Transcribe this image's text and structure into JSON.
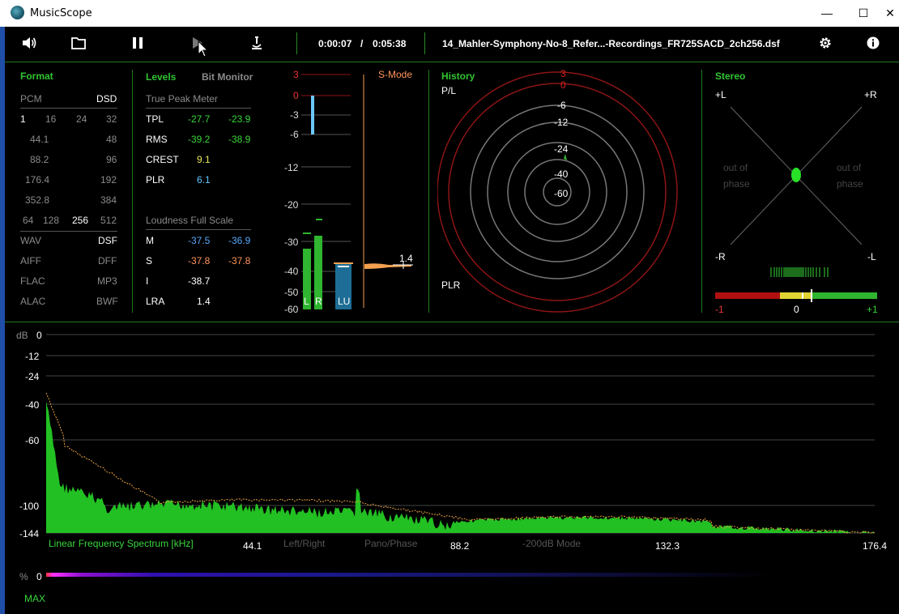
{
  "window": {
    "title": "MusicScope",
    "minimize": "—",
    "maximize": "☐",
    "close": "✕"
  },
  "toolbar": {
    "time_current": "0:00:07",
    "time_sep": "/",
    "time_total": "0:05:38",
    "filename": "14_Mahler-Symphony-No-8_Refer...-Recordings_FR725SACD_2ch256.dsf"
  },
  "format": {
    "title": "Format",
    "pcm": "PCM",
    "dsd": "DSD",
    "bits": [
      "1",
      "16",
      "24",
      "32"
    ],
    "rates_left": [
      "44.1",
      "88.2",
      "176.4",
      "352.8"
    ],
    "rates_right": [
      "48",
      "96",
      "192",
      "384"
    ],
    "dsd_rates": [
      "64",
      "128",
      "256",
      "512"
    ],
    "files_left": [
      "WAV",
      "AIFF",
      "FLAC",
      "ALAC"
    ],
    "files_right": [
      "DSF",
      "DFF",
      "MP3",
      "BWF"
    ]
  },
  "levels": {
    "title": "Levels",
    "bit_monitor": "Bit Monitor",
    "true_peak_title": "True Peak Meter",
    "tpl_label": "TPL",
    "tpl_l": "-27.7",
    "tpl_r": "-23.9",
    "rms_label": "RMS",
    "rms_l": "-39.2",
    "rms_r": "-38.9",
    "crest_label": "CREST",
    "crest": "9.1",
    "plr_label": "PLR",
    "plr": "6.1",
    "loudness_title": "Loudness Full Scale",
    "m_label": "M",
    "m_l": "-37.5",
    "m_r": "-36.9",
    "s_label": "S",
    "s_l": "-37.8",
    "s_r": "-37.8",
    "i_label": "I",
    "i": "-38.7",
    "lra_label": "LRA",
    "lra": "1.4"
  },
  "meter": {
    "scale": [
      "3",
      "0",
      "-3",
      "-6",
      "-12",
      "-20",
      "-30",
      "-40",
      "-50",
      "-60"
    ],
    "smode": "S-Mode",
    "lra_value": "1.4",
    "bar_l": "L",
    "bar_r": "R",
    "bar_lu": "LU"
  },
  "history": {
    "title": "History",
    "pl": "P/L",
    "plr": "PLR",
    "rings": [
      "3",
      "0",
      "-6",
      "-12",
      "-24",
      "-40",
      "-60"
    ]
  },
  "stereo": {
    "title": "Stereo",
    "plus_l": "+L",
    "plus_r": "+R",
    "minus_r": "-R",
    "minus_l": "-L",
    "out_of_phase_1": "out of",
    "out_of_phase_2": "phase",
    "scale_min": "-1",
    "scale_mid": "0",
    "scale_max": "+1"
  },
  "spectrum": {
    "db": "dB",
    "y_ticks": [
      "0",
      "-12",
      "-24",
      "-40",
      "-60",
      "-100",
      "-144"
    ],
    "x_ticks": [
      "44.1",
      "88.2",
      "132.3",
      "176.4"
    ],
    "title": "Linear Frequency Spectrum [kHz]",
    "mode_left_right": "Left/Right",
    "mode_pano": "Pano/Phase",
    "mode_200db": "-200dB Mode",
    "percent": "%",
    "percent_val": "0",
    "max": "MAX"
  },
  "colors": {
    "accent_green": "#31c431",
    "bar_green": "#2fb52f",
    "lu_blue": "#1d6d96",
    "ring_red": "#8b1515",
    "spectrum_green": "#22c022"
  }
}
